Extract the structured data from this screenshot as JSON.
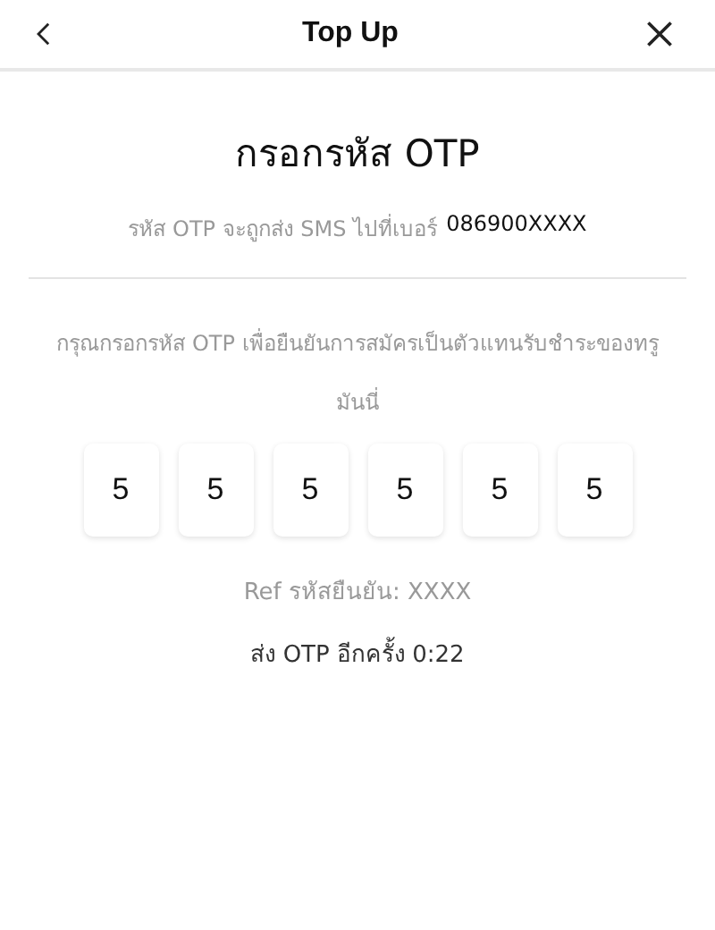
{
  "header": {
    "title": "Top Up"
  },
  "heading": "กรอกรหัส OTP",
  "sms_note": {
    "text": "รหัส OTP จะถูกส่ง SMS ไปที่เบอร์",
    "phone": "086900XXXX"
  },
  "instruction": "กรุณกรอกรหัส OTP เพื่อยืนยันการสมัครเป็นตัวแทนรับชำระของทรูมันนี่",
  "otp_digits": [
    "5",
    "5",
    "5",
    "5",
    "5",
    "5"
  ],
  "ref": "Ref รหัสยืนยัน: XXXX",
  "resend": "ส่ง OTP อีกครั้ง 0:22"
}
